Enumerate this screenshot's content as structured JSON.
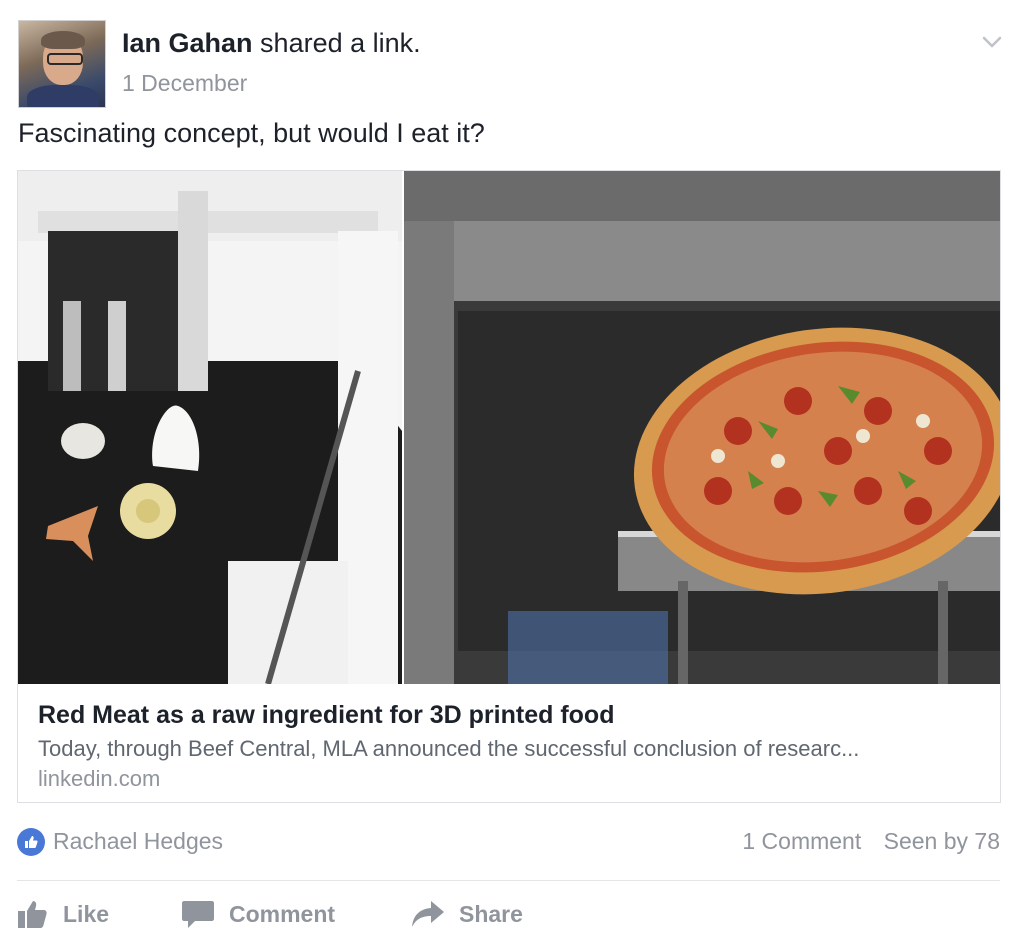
{
  "post": {
    "author": "Ian Gahan",
    "action": "shared a link.",
    "timestamp": "1 December",
    "text": "Fascinating concept, but would I eat it?"
  },
  "link": {
    "title": "Red Meat as a raw ingredient for 3D printed food",
    "description": "Today, through Beef Central, MLA announced the successful conclusion of researc...",
    "domain": "linkedin.com",
    "image_icon": "3d-food-printer-and-pizza-photo"
  },
  "reactions": {
    "reactor": "Rachael Hedges",
    "comments": "1 Comment",
    "seen": "Seen by 78"
  },
  "actions": {
    "like": "Like",
    "comment": "Comment",
    "share": "Share"
  },
  "colors": {
    "like_blue": "#4a78d6",
    "muted_text": "#90949c",
    "primary_text": "#1d2129"
  }
}
